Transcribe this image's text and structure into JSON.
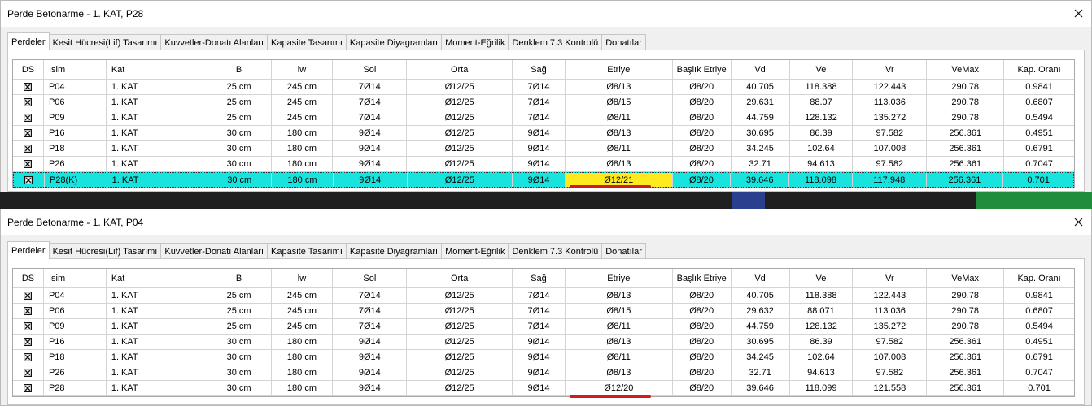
{
  "colors": {
    "selection": "#19e3de",
    "highlight": "#ffeb1d",
    "underline": "#d11a1a"
  },
  "columns": [
    "DS",
    "İsim",
    "Kat",
    "B",
    "lw",
    "Sol",
    "Orta",
    "Sağ",
    "Etriye",
    "Başlık Etriye",
    "Vd",
    "Ve",
    "Vr",
    "VeMax",
    "Kap. Oranı"
  ],
  "tabs": [
    "Perdeler",
    "Kesit Hücresi(Lif) Tasarımı",
    "Kuvvetler-Donatı Alanları",
    "Kapasite Tasarımı",
    "Kapasite Diyagramları",
    "Moment-Eğrilik",
    "Denklem 7.3 Kontrolü",
    "Donatılar"
  ],
  "windows": [
    {
      "title": "Perde Betonarme - 1. KAT, P28",
      "active_tab": 0,
      "selected_row": 6,
      "highlight_cell": {
        "row": 6,
        "col": 8
      },
      "rows": [
        [
          "",
          "P04",
          "1. KAT",
          "25 cm",
          "245 cm",
          "7Ø14",
          "Ø12/25",
          "7Ø14",
          "Ø8/13",
          "Ø8/20",
          "40.705",
          "118.388",
          "122.443",
          "290.78",
          "0.9841"
        ],
        [
          "",
          "P06",
          "1. KAT",
          "25 cm",
          "245 cm",
          "7Ø14",
          "Ø12/25",
          "7Ø14",
          "Ø8/15",
          "Ø8/20",
          "29.631",
          "88.07",
          "113.036",
          "290.78",
          "0.6807"
        ],
        [
          "",
          "P09",
          "1. KAT",
          "25 cm",
          "245 cm",
          "7Ø14",
          "Ø12/25",
          "7Ø14",
          "Ø8/11",
          "Ø8/20",
          "44.759",
          "128.132",
          "135.272",
          "290.78",
          "0.5494"
        ],
        [
          "",
          "P16",
          "1. KAT",
          "30 cm",
          "180 cm",
          "9Ø14",
          "Ø12/25",
          "9Ø14",
          "Ø8/13",
          "Ø8/20",
          "30.695",
          "86.39",
          "97.582",
          "256.361",
          "0.4951"
        ],
        [
          "",
          "P18",
          "1. KAT",
          "30 cm",
          "180 cm",
          "9Ø14",
          "Ø12/25",
          "9Ø14",
          "Ø8/11",
          "Ø8/20",
          "34.245",
          "102.64",
          "107.008",
          "256.361",
          "0.6791"
        ],
        [
          "",
          "P26",
          "1. KAT",
          "30 cm",
          "180 cm",
          "9Ø14",
          "Ø12/25",
          "9Ø14",
          "Ø8/13",
          "Ø8/20",
          "32.71",
          "94.613",
          "97.582",
          "256.361",
          "0.7047"
        ],
        [
          "",
          "P28(K)",
          "1. KAT",
          "30 cm",
          "180 cm",
          "9Ø14",
          "Ø12/25",
          "9Ø14",
          "Ø12/21",
          "Ø8/20",
          "39.646",
          "118.098",
          "117.948",
          "256.361",
          "0.701"
        ]
      ]
    },
    {
      "title": "Perde Betonarme - 1. KAT, P04",
      "active_tab": 0,
      "selected_row": -1,
      "highlight_cell": null,
      "rows": [
        [
          "",
          "P04",
          "1. KAT",
          "25 cm",
          "245 cm",
          "7Ø14",
          "Ø12/25",
          "7Ø14",
          "Ø8/13",
          "Ø8/20",
          "40.705",
          "118.388",
          "122.443",
          "290.78",
          "0.9841"
        ],
        [
          "",
          "P06",
          "1. KAT",
          "25 cm",
          "245 cm",
          "7Ø14",
          "Ø12/25",
          "7Ø14",
          "Ø8/15",
          "Ø8/20",
          "29.632",
          "88.071",
          "113.036",
          "290.78",
          "0.6807"
        ],
        [
          "",
          "P09",
          "1. KAT",
          "25 cm",
          "245 cm",
          "7Ø14",
          "Ø12/25",
          "7Ø14",
          "Ø8/11",
          "Ø8/20",
          "44.759",
          "128.132",
          "135.272",
          "290.78",
          "0.5494"
        ],
        [
          "",
          "P16",
          "1. KAT",
          "30 cm",
          "180 cm",
          "9Ø14",
          "Ø12/25",
          "9Ø14",
          "Ø8/13",
          "Ø8/20",
          "30.695",
          "86.39",
          "97.582",
          "256.361",
          "0.4951"
        ],
        [
          "",
          "P18",
          "1. KAT",
          "30 cm",
          "180 cm",
          "9Ø14",
          "Ø12/25",
          "9Ø14",
          "Ø8/11",
          "Ø8/20",
          "34.245",
          "102.64",
          "107.008",
          "256.361",
          "0.6791"
        ],
        [
          "",
          "P26",
          "1. KAT",
          "30 cm",
          "180 cm",
          "9Ø14",
          "Ø12/25",
          "9Ø14",
          "Ø8/13",
          "Ø8/20",
          "32.71",
          "94.613",
          "97.582",
          "256.361",
          "0.7047"
        ],
        [
          "",
          "P28",
          "1. KAT",
          "30 cm",
          "180 cm",
          "9Ø14",
          "Ø12/25",
          "9Ø14",
          "Ø12/20",
          "Ø8/20",
          "39.646",
          "118.099",
          "121.558",
          "256.361",
          "0.701"
        ]
      ]
    }
  ]
}
